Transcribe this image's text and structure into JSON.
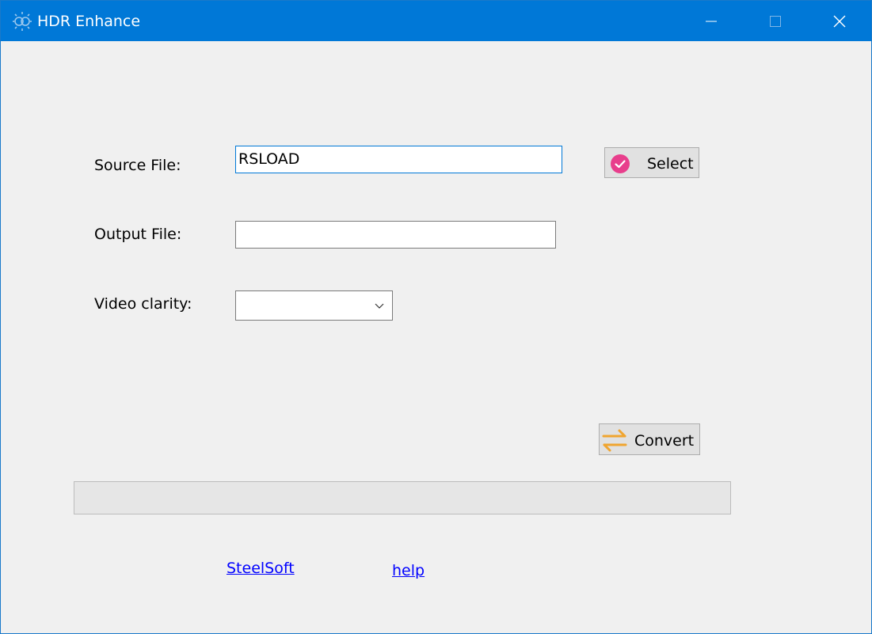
{
  "window": {
    "title": "HDR Enhance",
    "icon": "hdr-app-icon",
    "controls": [
      "minimize-icon",
      "maximize-icon",
      "close-icon"
    ]
  },
  "form": {
    "source_label": "Source File:",
    "source_value": "RSLOAD",
    "output_label": "Output File:",
    "output_value": "",
    "clarity_label": "Video clarity:",
    "clarity_value": ""
  },
  "buttons": {
    "select_label": "Select",
    "select_icon": "check-circle-icon",
    "convert_label": "Convert",
    "convert_icon": "swap-arrows-icon"
  },
  "progress": {
    "value": 0
  },
  "links": {
    "steelsoft": "SteelSoft",
    "help": "help"
  },
  "colors": {
    "titlebar": "#0078d7",
    "select_icon": "#e83e8c",
    "convert_icon": "#f0a530",
    "link": "#0000ff"
  }
}
